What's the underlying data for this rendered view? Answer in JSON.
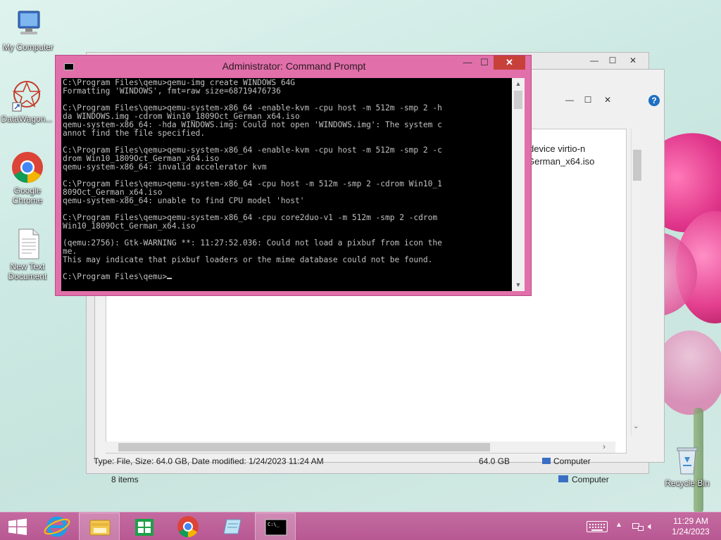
{
  "desktop": {
    "icons": [
      {
        "label": "My Computer"
      },
      {
        "label": "DataWagon..."
      },
      {
        "label": "Google Chrome"
      },
      {
        "label": "New Text Document"
      },
      {
        "label": "Recycle Bin"
      }
    ]
  },
  "explorer": {
    "text_fragment_1": "device virtio-n",
    "text_fragment_2": "German_x64.iso",
    "status_line": "Type: File, Size: 64.0 GB, Date modified: 1/24/2023 11:24 AM",
    "size_col": "64.0 GB",
    "location_col": "Computer",
    "items_count": "8 items",
    "location_footer": "Computer"
  },
  "cmd": {
    "title": "Administrator: Command Prompt",
    "lines": [
      "C:\\Program Files\\qemu>qemu-img create WINDOWS 64G",
      "Formatting 'WINDOWS', fmt=raw size=68719476736",
      "",
      "C:\\Program Files\\qemu>qemu-system-x86_64 -enable-kvm -cpu host -m 512m -smp 2 -h",
      "da WINDOWS.img -cdrom Win10_1809Oct_German_x64.iso",
      "qemu-system-x86_64: -hda WINDOWS.img: Could not open 'WINDOWS.img': The system c",
      "annot find the file specified.",
      "",
      "C:\\Program Files\\qemu>qemu-system-x86_64 -enable-kvm -cpu host -m 512m -smp 2 -c",
      "drom Win10_1809Oct_German_x64.iso",
      "qemu-system-x86_64: invalid accelerator kvm",
      "",
      "C:\\Program Files\\qemu>qemu-system-x86_64 -cpu host -m 512m -smp 2 -cdrom Win10_1",
      "809Oct_German_x64.iso",
      "qemu-system-x86_64: unable to find CPU model 'host'",
      "",
      "C:\\Program Files\\qemu>qemu-system-x86_64 -cpu core2duo-v1 -m 512m -smp 2 -cdrom",
      "Win10_1809Oct_German_x64.iso",
      "",
      "(qemu:2756): Gtk-WARNING **: 11:27:52.036: Could not load a pixbuf from icon the",
      "me.",
      "This may indicate that pixbuf loaders or the mime database could not be found.",
      ""
    ],
    "prompt": "C:\\Program Files\\qemu>"
  },
  "taskbar": {
    "time": "11:29 AM",
    "date": "1/24/2023"
  },
  "icons": {
    "start": "windows-logo-icon",
    "ie": "internet-explorer-icon",
    "explorer": "file-explorer-icon",
    "store": "store-icon",
    "chrome": "chrome-icon",
    "notepad": "notepad-icon",
    "cmd": "command-prompt-icon"
  },
  "colors": {
    "cmd_frame": "#e16faa",
    "taskbar": "#b85893",
    "close_button": "#c7403a"
  }
}
